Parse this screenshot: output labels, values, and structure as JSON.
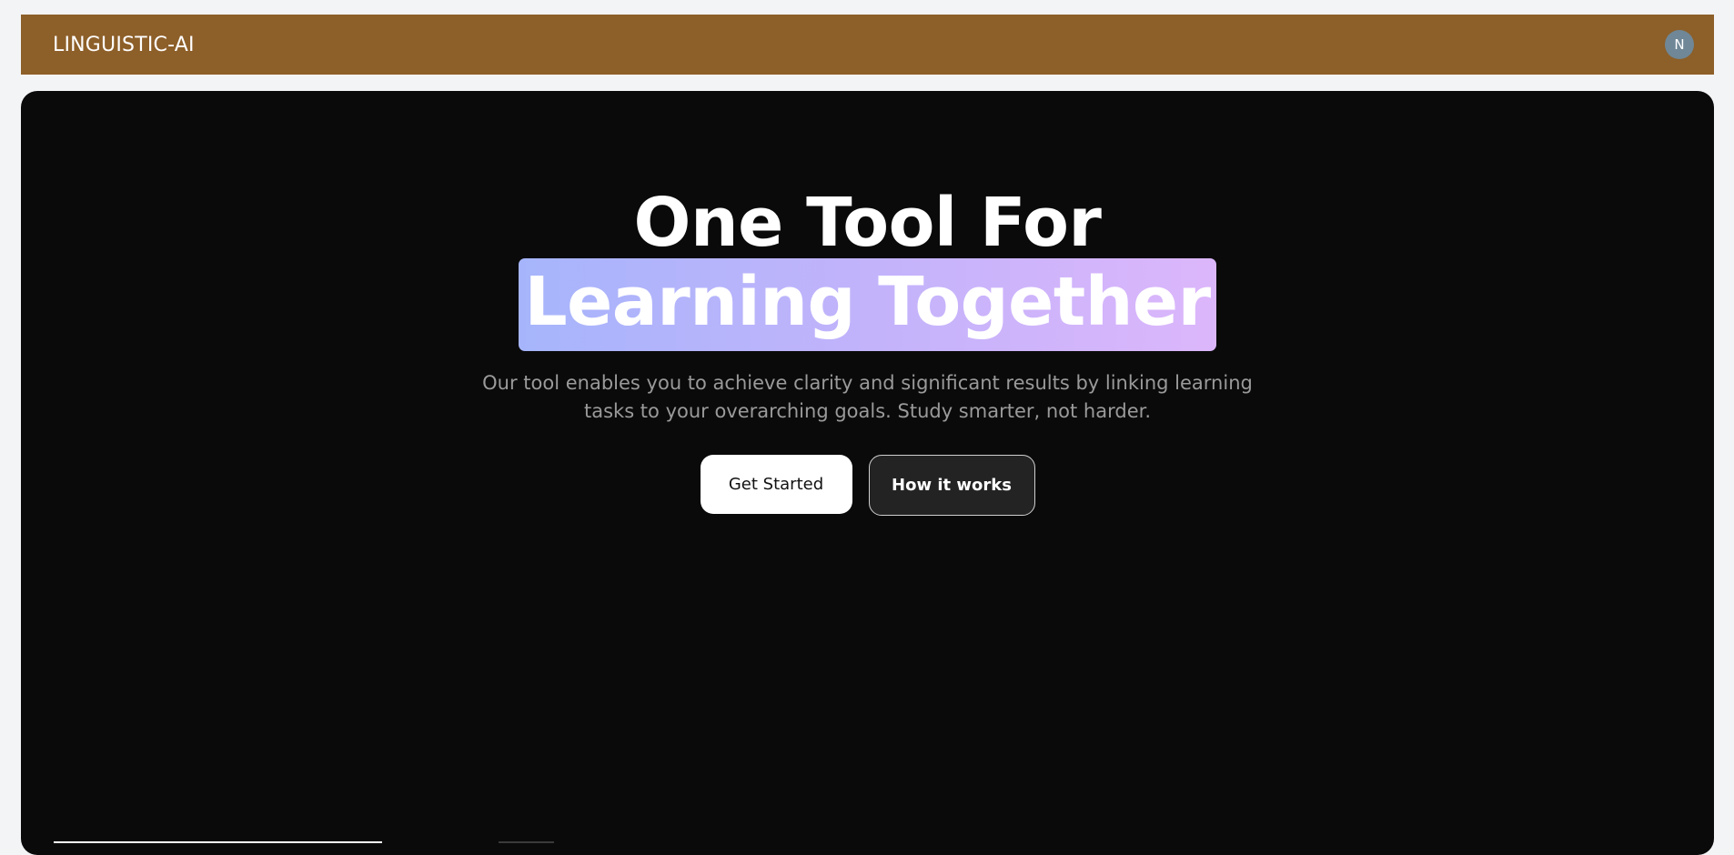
{
  "header": {
    "brand": "LINGUISTIC-AI",
    "avatar_initial": "N",
    "bg_color": "#8d5f29",
    "avatar_color": "#6f8796"
  },
  "hero": {
    "headline_line1": "One Tool For",
    "headline_highlight": "Learning Together",
    "subtext_line1": "Our tool enables you to achieve clarity and significant results by linking learning",
    "subtext_line2": "tasks to your overarching goals. Study smarter, not harder.",
    "primary_button": "Get Started",
    "secondary_button": "How it works",
    "bg_color": "#0a0a0a",
    "highlight_gradient": [
      "#a6b5fb",
      "#dcb6fb"
    ]
  }
}
